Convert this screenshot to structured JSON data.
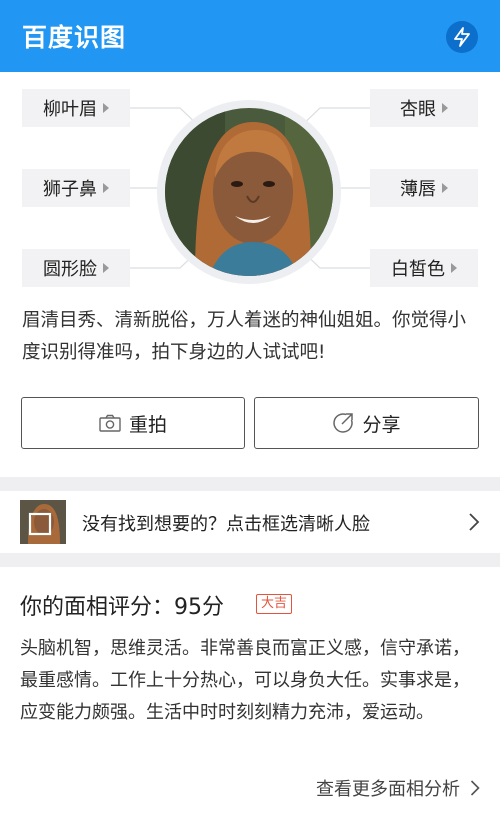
{
  "app": {
    "title": "百度识图",
    "action_icon": "lightning-icon",
    "accent_color": "#2196f3"
  },
  "features": {
    "eyebrow": "柳叶眉",
    "nose": "狮子鼻",
    "face": "圆形脸",
    "eyes": "杏眼",
    "lips": "薄唇",
    "skin": "白皙色"
  },
  "description": "眉清目秀、清新脱俗，万人着迷的神仙姐姐。你觉得小度识别得准吗，拍下身边的人试试吧!",
  "buttons": {
    "retake": "重拍",
    "share": "分享"
  },
  "reselect": {
    "text": "没有找到想要的？点击框选清晰人脸"
  },
  "score": {
    "label": "你的面相评分：95分",
    "badge": "大吉",
    "badge_color": "#e2543d",
    "analysis": "头脑机智，思维灵活。非常善良而富正义感，信守承诺，最重感情。工作上十分热心，可以身负大任。实事求是，应变能力颇强。生活中时时刻刻精力充沛，爱运动。",
    "more": "查看更多面相分析"
  }
}
